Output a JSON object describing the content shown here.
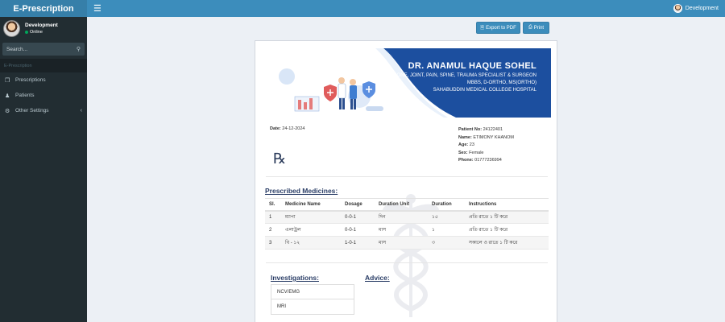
{
  "app": {
    "brand": "E-Prescription"
  },
  "topbar": {
    "user": "Development"
  },
  "sidebar": {
    "user_name": "Development",
    "status": "Online",
    "search_placeholder": "Search...",
    "header": "E-Prescription",
    "items": [
      {
        "label": "Prescriptions",
        "icon": "prescription-icon"
      },
      {
        "label": "Patients",
        "icon": "user-icon"
      },
      {
        "label": "Other Settings",
        "icon": "gear-icon"
      }
    ]
  },
  "toolbar": {
    "export_label": "Export to PDF",
    "print_label": "Print"
  },
  "doctor": {
    "name": "DR. ANAMUL HAQUE SOHEL",
    "specialty": "BONE, JOINT, PAIN, SPINE, TRAUMA SPECIALIST & SURGEON",
    "degrees": "MBBS, D-ORTHO, MS(ORTHO)",
    "hospital": "SAHABUDDIN MEDICAL COLLEGE HOSPITAL"
  },
  "prescription": {
    "date_label": "Date:",
    "date": "24-12-2024",
    "rx_symbol": "℞"
  },
  "patient": {
    "no_label": "Patient No:",
    "no": "24122401",
    "name_label": "Name:",
    "name": "ETIMONY KHANOM",
    "age_label": "Age:",
    "age": "23",
    "sex_label": "Sex:",
    "sex": "Female",
    "phone_label": "Phone:",
    "phone": "01777236994"
  },
  "medicines": {
    "title": "Prescribed Medicines:",
    "headers": [
      "Sl.",
      "Medicine Name",
      "Dosage",
      "Duration Unit",
      "Duration",
      "Instructions"
    ],
    "rows": [
      [
        "1",
        "ম্যাপা",
        "0-0-1",
        "দিন",
        "১৫",
        "প্রতি রাতে ১ টি করে"
      ],
      [
        "2",
        "এলাট্রল",
        "0-0-1",
        "মাস",
        "১",
        "প্রতি রাতে ১ টি করে"
      ],
      [
        "3",
        "বি - ১২",
        "1-0-1",
        "মাস",
        "৩",
        "সকালে ও রাতে ১ টি করে"
      ]
    ]
  },
  "investigations": {
    "title": "Investigations:",
    "items": [
      "NCV/EMG",
      "MRI"
    ]
  },
  "advice": {
    "title": "Advice:"
  },
  "colors": {
    "primary": "#3c8dbc",
    "sidebar": "#222d32",
    "banner": "#1c4f9f",
    "heading": "#2a3d66"
  }
}
